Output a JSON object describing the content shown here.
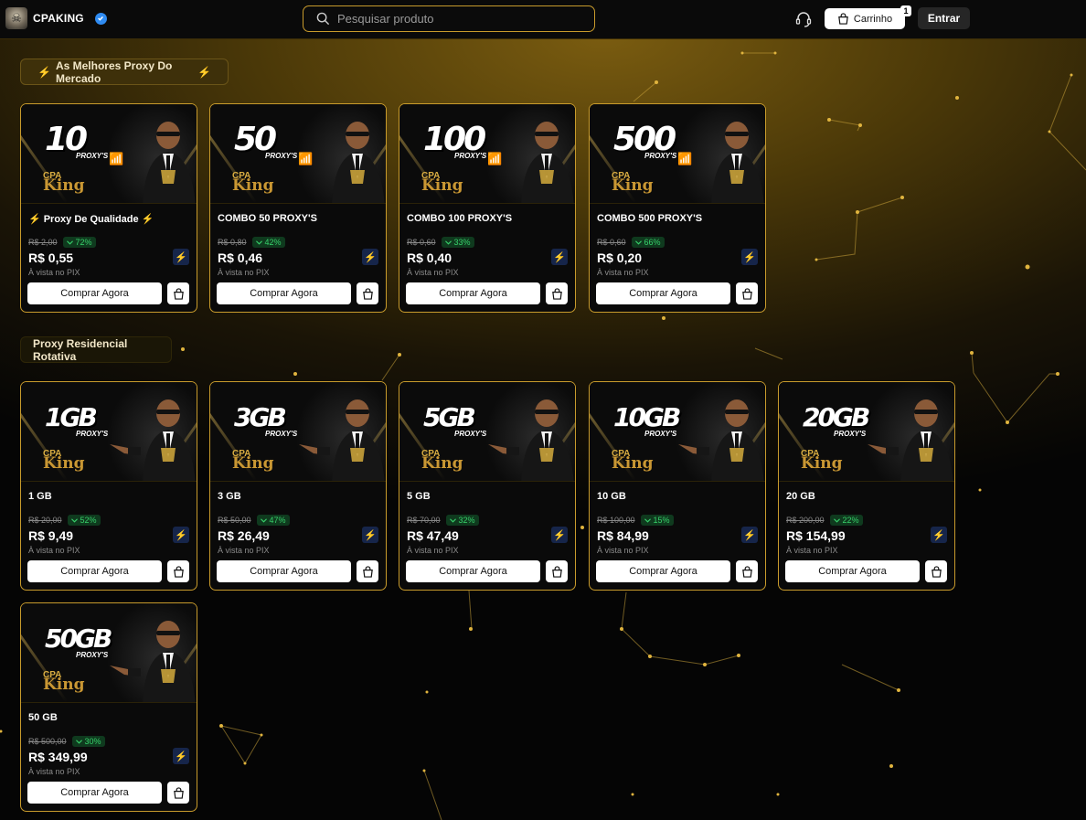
{
  "header": {
    "brand": "CPAKING",
    "search_placeholder": "Pesquisar produto",
    "cart_label": "Carrinho",
    "cart_count": "1",
    "login_label": "Entrar"
  },
  "sections": {
    "best": {
      "title": "As Melhores Proxy Do Mercado"
    },
    "residential": {
      "title": "Proxy Residencial Rotativa"
    }
  },
  "common": {
    "buy_label": "Comprar Agora",
    "pix_label": "À vista no PIX",
    "banner_suffix": "PROXY'S",
    "banner_brand_top": "CPA",
    "banner_brand_bottom": "King"
  },
  "products": [
    {
      "banner": "10",
      "title_pre": "Proxy De Qualidade",
      "old": "R$ 2,00",
      "discount": "72%",
      "price": "R$ 0,55"
    },
    {
      "banner": "50",
      "title_pre": "COMBO 50 PROXY'S",
      "old": "R$ 0,80",
      "discount": "42%",
      "price": "R$ 0,46"
    },
    {
      "banner": "100",
      "title_pre": "COMBO 100 PROXY'S",
      "old": "R$ 0,60",
      "discount": "33%",
      "price": "R$ 0,40"
    },
    {
      "banner": "500",
      "title_pre": "COMBO 500 PROXY'S",
      "old": "R$ 0,60",
      "discount": "66%",
      "price": "R$ 0,20"
    },
    {
      "banner": "1GB",
      "title_pre": "1 GB",
      "old": "R$ 20,00",
      "discount": "52%",
      "price": "R$ 9,49"
    },
    {
      "banner": "3GB",
      "title_pre": "3 GB",
      "old": "R$ 50,00",
      "discount": "47%",
      "price": "R$ 26,49"
    },
    {
      "banner": "5GB",
      "title_pre": "5 GB",
      "old": "R$ 70,00",
      "discount": "32%",
      "price": "R$ 47,49"
    },
    {
      "banner": "10GB",
      "title_pre": "10 GB",
      "old": "R$ 100,00",
      "discount": "15%",
      "price": "R$ 84,99"
    },
    {
      "banner": "20GB",
      "title_pre": "20 GB",
      "old": "R$ 200,00",
      "discount": "22%",
      "price": "R$ 154,99"
    },
    {
      "banner": "50GB",
      "title_pre": "50 GB",
      "old": "R$ 500,00",
      "discount": "30%",
      "price": "R$ 349,99"
    }
  ],
  "colors": {
    "accent": "#c89b2c",
    "discount": "#37d06a",
    "flash": "#4b8bff"
  }
}
